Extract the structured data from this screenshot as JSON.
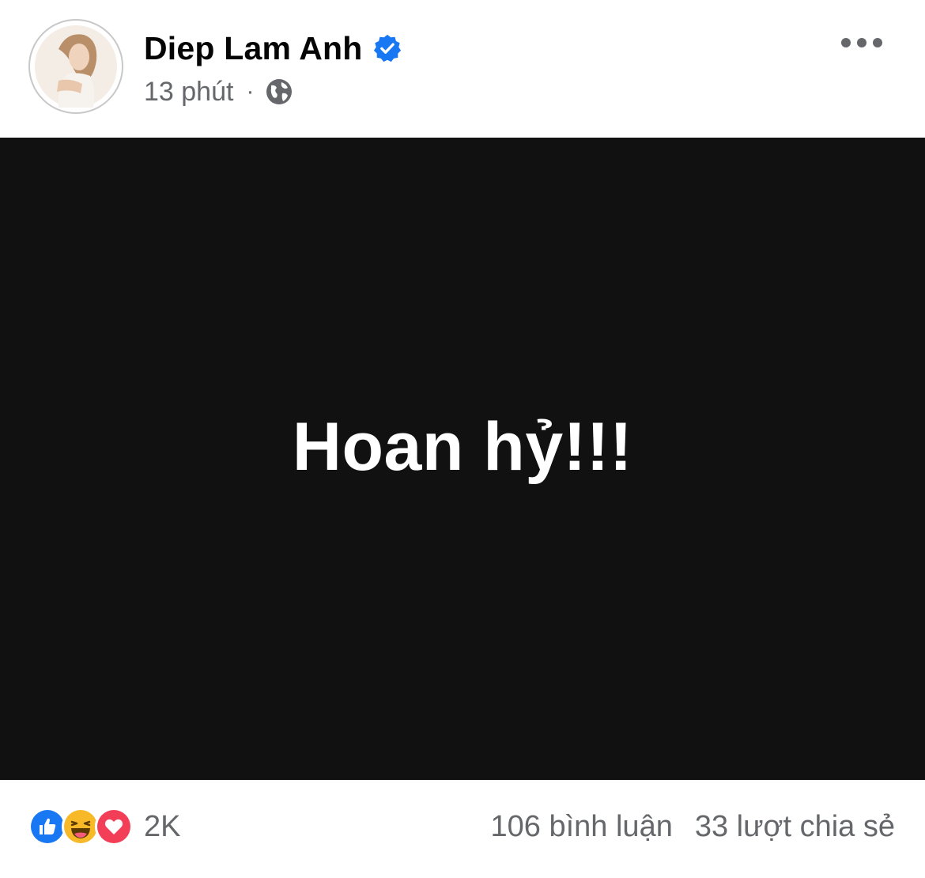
{
  "post": {
    "author": "Diep Lam Anh",
    "time": "13 phút",
    "separator": "·",
    "content_text": "Hoan hỷ!!!"
  },
  "icons": {
    "verified": "verified-badge-icon",
    "audience": "globe-icon",
    "more": "more-options-icon",
    "reactions": [
      "like-icon",
      "haha-icon",
      "love-icon"
    ]
  },
  "engagement": {
    "reaction_count": "2K",
    "comments": "106 bình luận",
    "shares": "33 lượt chia sẻ"
  },
  "colors": {
    "verified_blue": "#1877f2",
    "like_blue": "#1877f2",
    "love_red": "#f33e58",
    "haha_yellow": "#f7b928",
    "muted_text": "#65676b",
    "media_bg": "#111111"
  }
}
